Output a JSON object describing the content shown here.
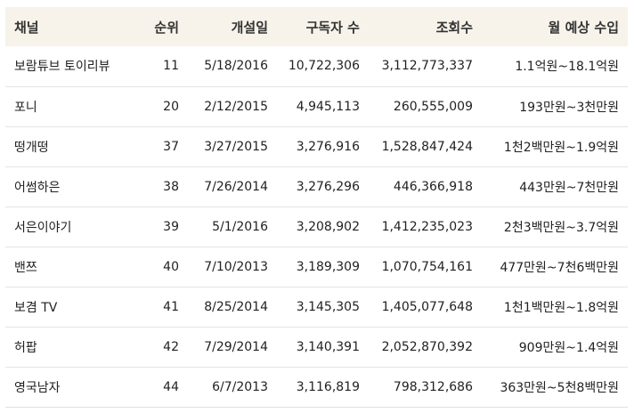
{
  "table": {
    "headers": [
      "채널",
      "순위",
      "개설일",
      "구독자 수",
      "조회수",
      "월 예상 수입"
    ],
    "rows": [
      [
        "보람튜브 토이리뷰",
        "11",
        "5/18/2016",
        "10,722,306",
        "3,112,773,337",
        "1.1억원~18.1억원"
      ],
      [
        "포니",
        "20",
        "2/12/2015",
        "4,945,113",
        "260,555,009",
        "193만원~3천만원"
      ],
      [
        "떵개떵",
        "37",
        "3/27/2015",
        "3,276,916",
        "1,528,847,424",
        "1천2백만원~1.9억원"
      ],
      [
        "어썸하은",
        "38",
        "7/26/2014",
        "3,276,296",
        "446,366,918",
        "443만원~7천만원"
      ],
      [
        "서은이야기",
        "39",
        "5/1/2016",
        "3,208,902",
        "1,412,235,023",
        "2천3백만원~3.7억원"
      ],
      [
        "밴쯔",
        "40",
        "7/10/2013",
        "3,189,309",
        "1,070,754,161",
        "477만원~7천6백만원"
      ],
      [
        "보겸 TV",
        "41",
        "8/25/2014",
        "3,145,305",
        "1,405,077,648",
        "1천1백만원~1.8억원"
      ],
      [
        "허팝",
        "42",
        "7/29/2014",
        "3,140,391",
        "2,052,870,392",
        "909만원~1.4억원"
      ],
      [
        "영국남자",
        "44",
        "6/7/2013",
        "3,116,819",
        "798,312,686",
        "363만원~5천8백만원"
      ]
    ]
  },
  "colors": {
    "header_bg": "#f7f3ea",
    "row_border": "#e4e4e4",
    "text": "#222222"
  }
}
